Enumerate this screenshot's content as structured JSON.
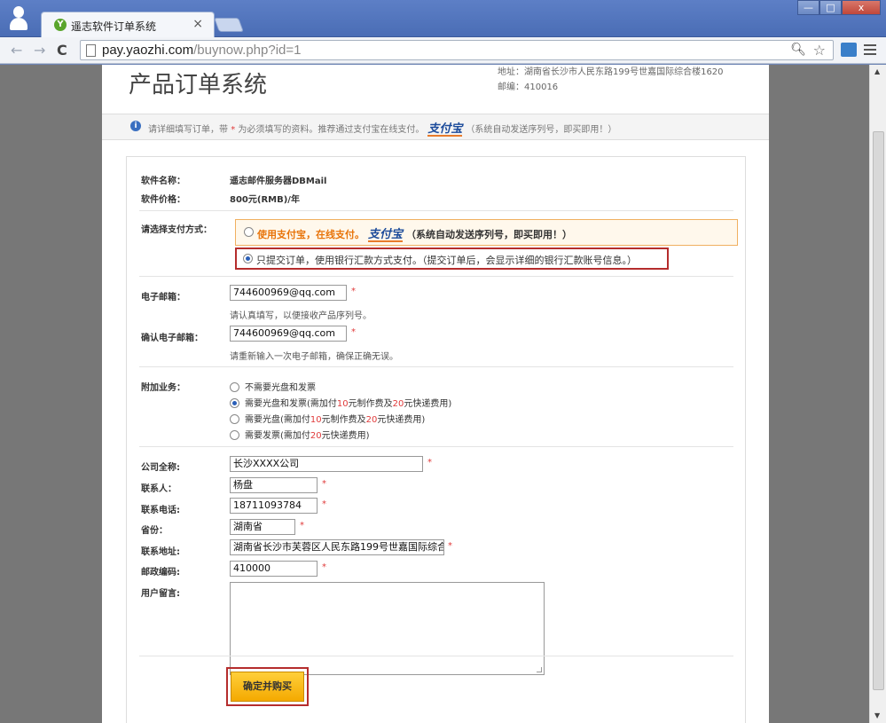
{
  "browser": {
    "tab_title": "遥志软件订单系统",
    "tab_close": "×",
    "url_host": "pay.yaozhi.com",
    "url_path": "/buynow.php?id=1",
    "window_min": "—",
    "window_max": "□",
    "window_close": "x"
  },
  "header": {
    "title": "产品订单系统",
    "address": "地址：湖南省长沙市人民东路199号世嘉国际综合楼1620",
    "postcode": "邮编：410016"
  },
  "notice": {
    "text_before": "请详细填写订单，带",
    "star": "*",
    "text_middle": "为必须填写的资料。推荐通过支付宝在线支付。",
    "alipay": "支付宝",
    "text_after": "（系统自动发送序列号，即买即用！）"
  },
  "product": {
    "name_label": "软件名称：",
    "name_value": "遥志邮件服务器DBMail",
    "price_label": "软件价格：",
    "price_value": "800元(RMB)/年"
  },
  "payment": {
    "label": "请选择支付方式：",
    "option1_part1": "使用支付宝，在线支付。",
    "option1_alipay": "支付宝",
    "option1_part2": "（系统自动发送序列号，即买即用！）",
    "option2": "只提交订单，使用银行汇款方式支付。（提交订单后，会显示详细的银行汇款账号信息。）"
  },
  "email": {
    "label": "电子邮箱：",
    "value": "744600969@qq.com",
    "hint": "请认真填写，以便接收产品序列号。",
    "confirm_label": "确认电子邮箱：",
    "confirm_value": "744600969@qq.com",
    "confirm_hint": "请重新输入一次电子邮箱，确保正确无误。"
  },
  "addons": {
    "label": "附加业务：",
    "options": [
      {
        "label": "不需要光盘和发票"
      },
      {
        "label_pre": "需要光盘和发票(需加付",
        "n1": "10",
        "mid": "元制作费及",
        "n2": "20",
        "post": "元快递费用)"
      },
      {
        "label_pre": "需要光盘(需加付",
        "n1": "10",
        "mid": "元制作费及",
        "n2": "20",
        "post": "元快递费用)"
      },
      {
        "label_pre": "需要发票(需加付",
        "n1": "20",
        "post": "元快递费用)"
      }
    ]
  },
  "contact": {
    "company_label": "公司全称:",
    "company_value": "长沙XXXX公司",
    "person_label": "联系人：",
    "person_value": "杨盘",
    "phone_label": "联系电话:",
    "phone_value": "18711093784",
    "province_label": "省份：",
    "province_value": "湖南省",
    "address_label": "联系地址:",
    "address_value": "湖南省长沙市芙蓉区人民东路199号世嘉国际综合",
    "zip_label": "邮政编码:",
    "zip_value": "410000",
    "message_label": "用户留言:",
    "required": "*"
  },
  "submit": {
    "label": "确定并购买"
  }
}
